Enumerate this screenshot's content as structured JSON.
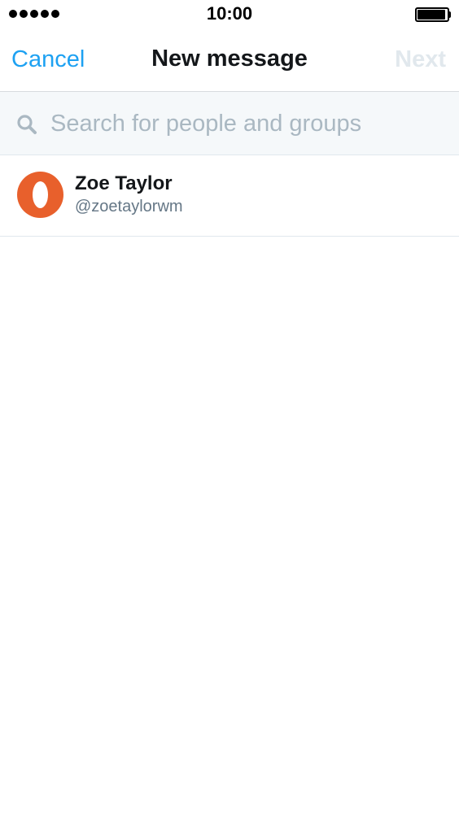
{
  "status_bar": {
    "time": "10:00",
    "signal_dots": 5
  },
  "nav": {
    "cancel_label": "Cancel",
    "title": "New message",
    "next_label": "Next"
  },
  "search": {
    "placeholder": "Search for people and groups",
    "value": ""
  },
  "contacts": [
    {
      "name": "Zoe Taylor",
      "handle": "@zoetaylorwm",
      "avatar_color": "#e8602c"
    }
  ],
  "colors": {
    "accent": "#1da1f2",
    "disabled": "#e1e8ed",
    "secondary_text": "#657786",
    "placeholder": "#aab8c2"
  }
}
